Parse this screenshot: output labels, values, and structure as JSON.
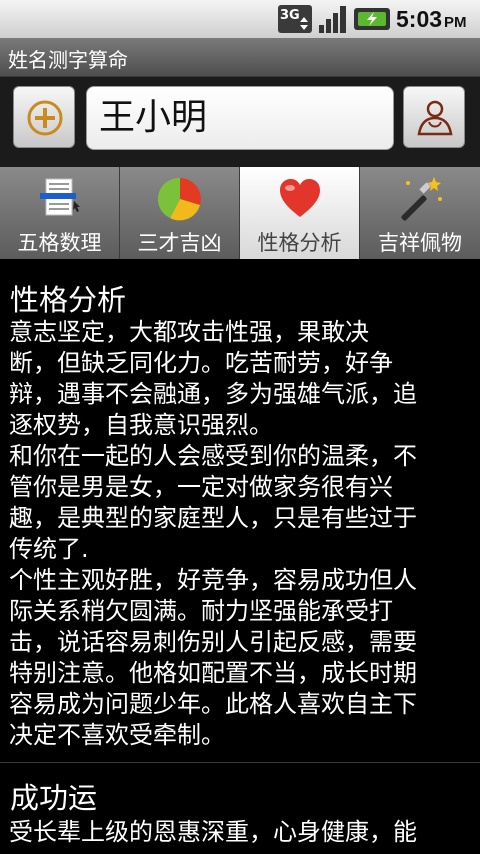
{
  "status_bar": {
    "network": "3G",
    "time": "5:03",
    "ampm": "PM"
  },
  "app": {
    "title": "姓名测字算命"
  },
  "name_input": {
    "value": "王小明"
  },
  "tabs": [
    {
      "label": "五格数理",
      "icon": "document-icon"
    },
    {
      "label": "三才吉凶",
      "icon": "pie-chart-icon"
    },
    {
      "label": "性格分析",
      "icon": "heart-icon",
      "active": true
    },
    {
      "label": "吉祥佩物",
      "icon": "magic-wand-icon"
    }
  ],
  "content": {
    "section1_title": "性格分析",
    "section1_text": "意志坚定，大都攻击性强，果敢决\n断，但缺乏同化力。吃苦耐劳，好争\n辩，遇事不会融通，多为强雄气派，追\n逐权势，自我意识强烈。\n和你在一起的人会感受到你的温柔，不\n管你是男是女，一定对做家务很有兴\n趣，是典型的家庭型人，只是有些过于\n传统了.\n个性主观好胜，好竞争，容易成功但人\n际关系稍欠圆满。耐力坚强能承受打\n击，说话容易刺伤别人引起反感，需要\n特别注意。他格如配置不当，成长时期\n容易成为问题少年。此格人喜欢自主下\n决定不喜欢受牵制。",
    "section2_title": "成功运",
    "section2_text": "受长辈上级的恩惠深重，心身健康，能"
  }
}
